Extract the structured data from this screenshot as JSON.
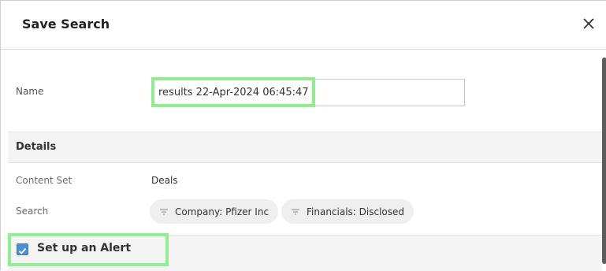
{
  "dialog": {
    "title": "Save Search",
    "close_icon": "close-icon"
  },
  "form": {
    "name_label": "Name",
    "name_value": "results 22-Apr-2024 06:45:47"
  },
  "details": {
    "section_title": "Details",
    "content_set_label": "Content Set",
    "content_set_value": "Deals",
    "search_label": "Search",
    "search_chips": [
      {
        "label": "Company: Pfizer Inc",
        "icon": "filter-icon"
      },
      {
        "label": "Financials: Disclosed",
        "icon": "filter-icon"
      }
    ]
  },
  "alert": {
    "label": "Set up an Alert",
    "checked": true
  },
  "colors": {
    "highlight": "#90ee90",
    "checkbox": "#4a90d9",
    "section_bg": "#f4f4f4",
    "chip_bg": "#efefef"
  }
}
